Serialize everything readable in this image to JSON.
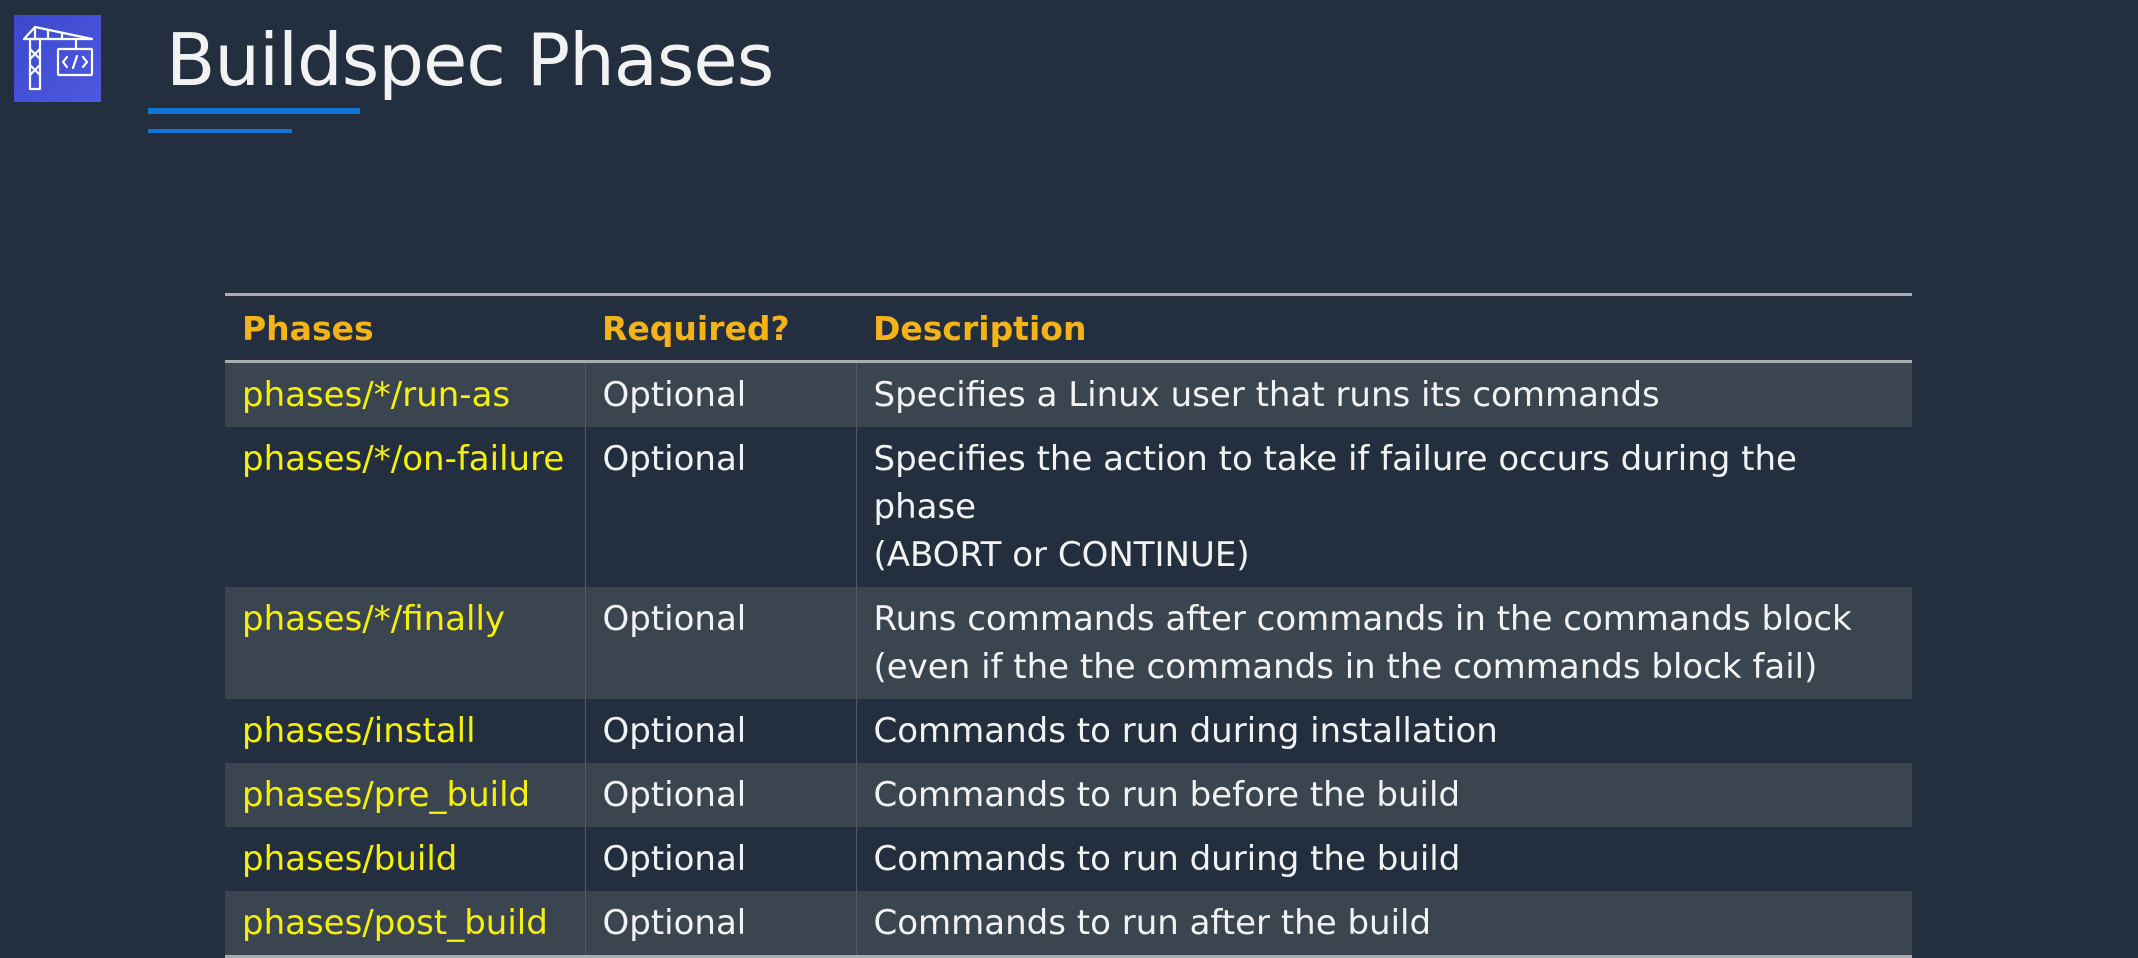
{
  "slide": {
    "title": "Buildspec Phases",
    "logo_icon": "codebuild-crane-icon",
    "accent_color": "#0f75d6",
    "background_color": "#232f3e"
  },
  "table": {
    "headers": [
      "Phases",
      "Required?",
      "Description"
    ],
    "rows": [
      {
        "phase": "phases/*/run-as",
        "required": "Optional",
        "description_lines": [
          "Specifies a Linux user that runs its commands"
        ]
      },
      {
        "phase": "phases/*/on-failure",
        "required": "Optional",
        "description_lines": [
          "Specifies the action to take if failure occurs during the phase",
          "(ABORT or CONTINUE)"
        ]
      },
      {
        "phase": "phases/*/finally",
        "required": "Optional",
        "description_lines": [
          "Runs commands after commands in the commands block",
          "(even if the the commands in the commands block fail)"
        ]
      },
      {
        "phase": "phases/install",
        "required": "Optional",
        "description_lines": [
          "Commands to run during installation"
        ]
      },
      {
        "phase": "phases/pre_build",
        "required": "Optional",
        "description_lines": [
          "Commands to run before the build"
        ]
      },
      {
        "phase": "phases/build",
        "required": "Optional",
        "description_lines": [
          "Commands to run during the build"
        ]
      },
      {
        "phase": "phases/post_build",
        "required": "Optional",
        "description_lines": [
          "Commands to run after the build"
        ]
      }
    ],
    "colors": {
      "header_text": "#f5b31a",
      "phase_text": "#f4f00c",
      "body_text": "#f2f2f2",
      "stripe_row": "#3b4550"
    }
  }
}
